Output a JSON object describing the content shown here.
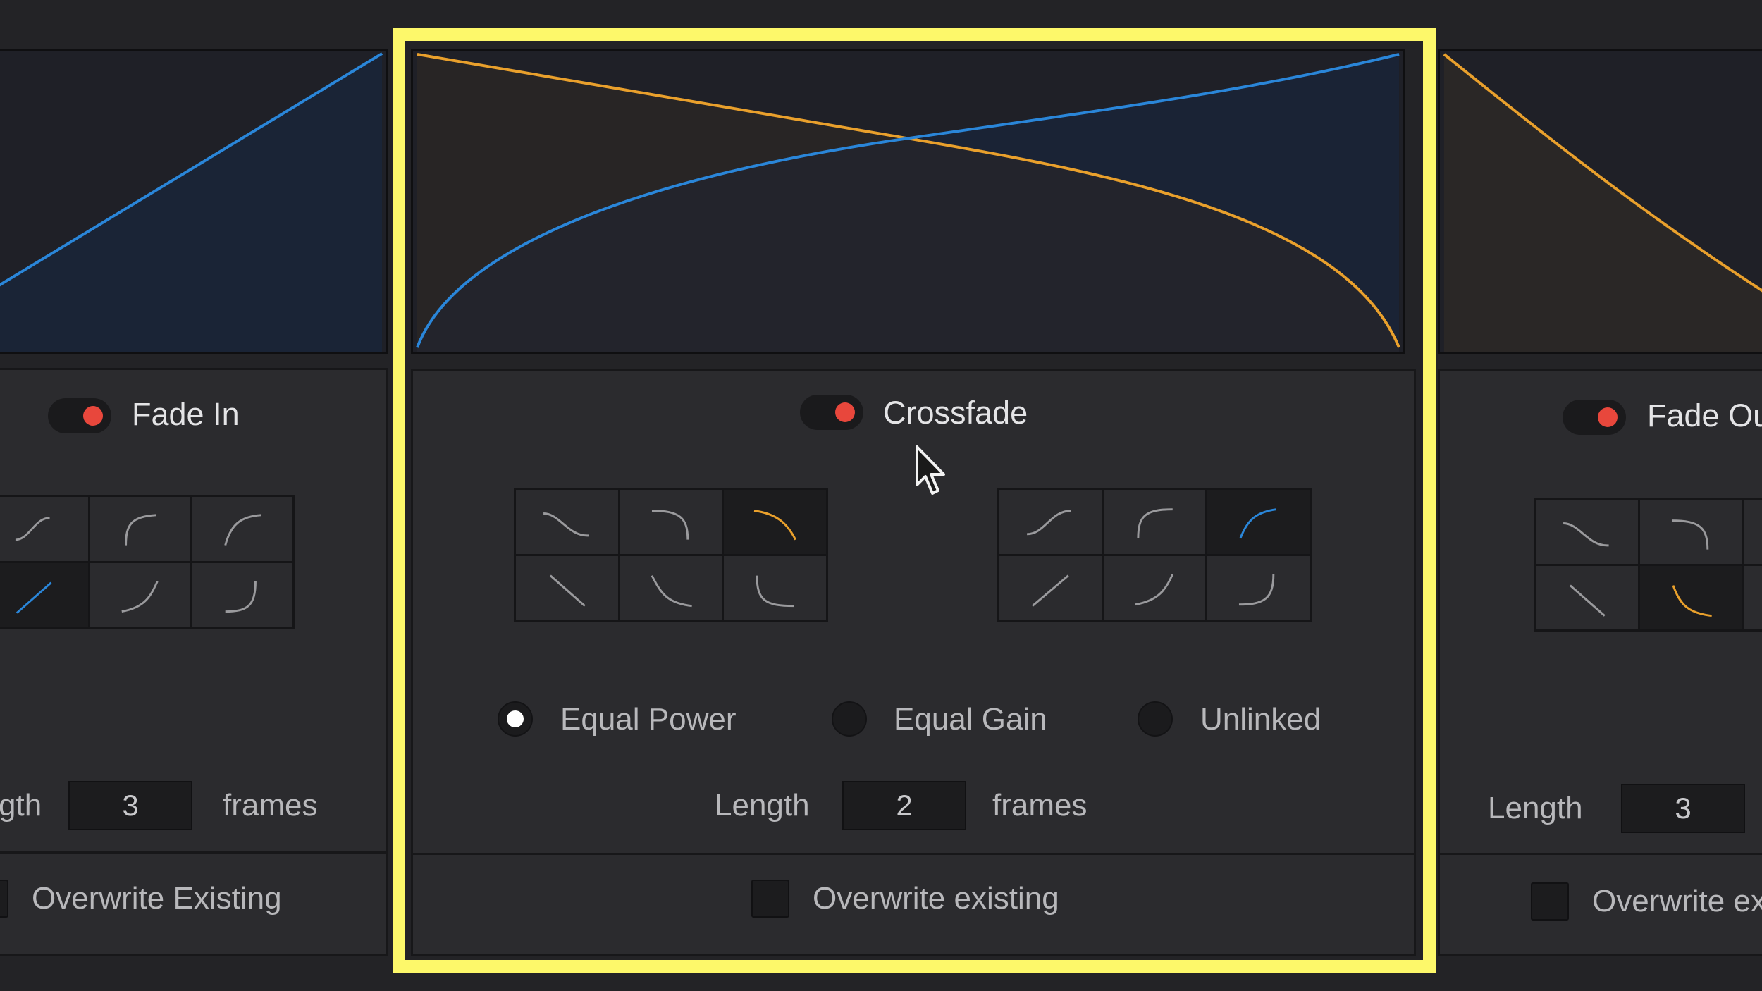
{
  "panels": {
    "fade_in": {
      "title": "Fade In",
      "length_label": "Length",
      "length_label_visible": "gth",
      "length_value": "3",
      "unit": "frames",
      "overwrite_label": "Overwrite Existing"
    },
    "crossfade": {
      "title": "Crossfade",
      "modes": [
        "Equal Power",
        "Equal Gain",
        "Unlinked"
      ],
      "selected_mode": "Equal Power",
      "length_label": "Length",
      "length_value": "2",
      "unit": "frames",
      "overwrite_label": "Overwrite existing"
    },
    "fade_out": {
      "title": "Fade Ou",
      "length_label": "Length",
      "length_value": "3",
      "overwrite_label": "Overwrite ex"
    }
  },
  "colors": {
    "fade_in_curve": "#2a86d9",
    "fade_out_curve": "#e9a02c",
    "highlight_border": "#fdf86a",
    "toggle_knob": "#e8473c"
  },
  "icons": [
    "s-curve-icon",
    "ease-out-icon",
    "ease-in-icon",
    "linear-icon",
    "toggle-on-icon",
    "mouse-pointer-icon"
  ]
}
